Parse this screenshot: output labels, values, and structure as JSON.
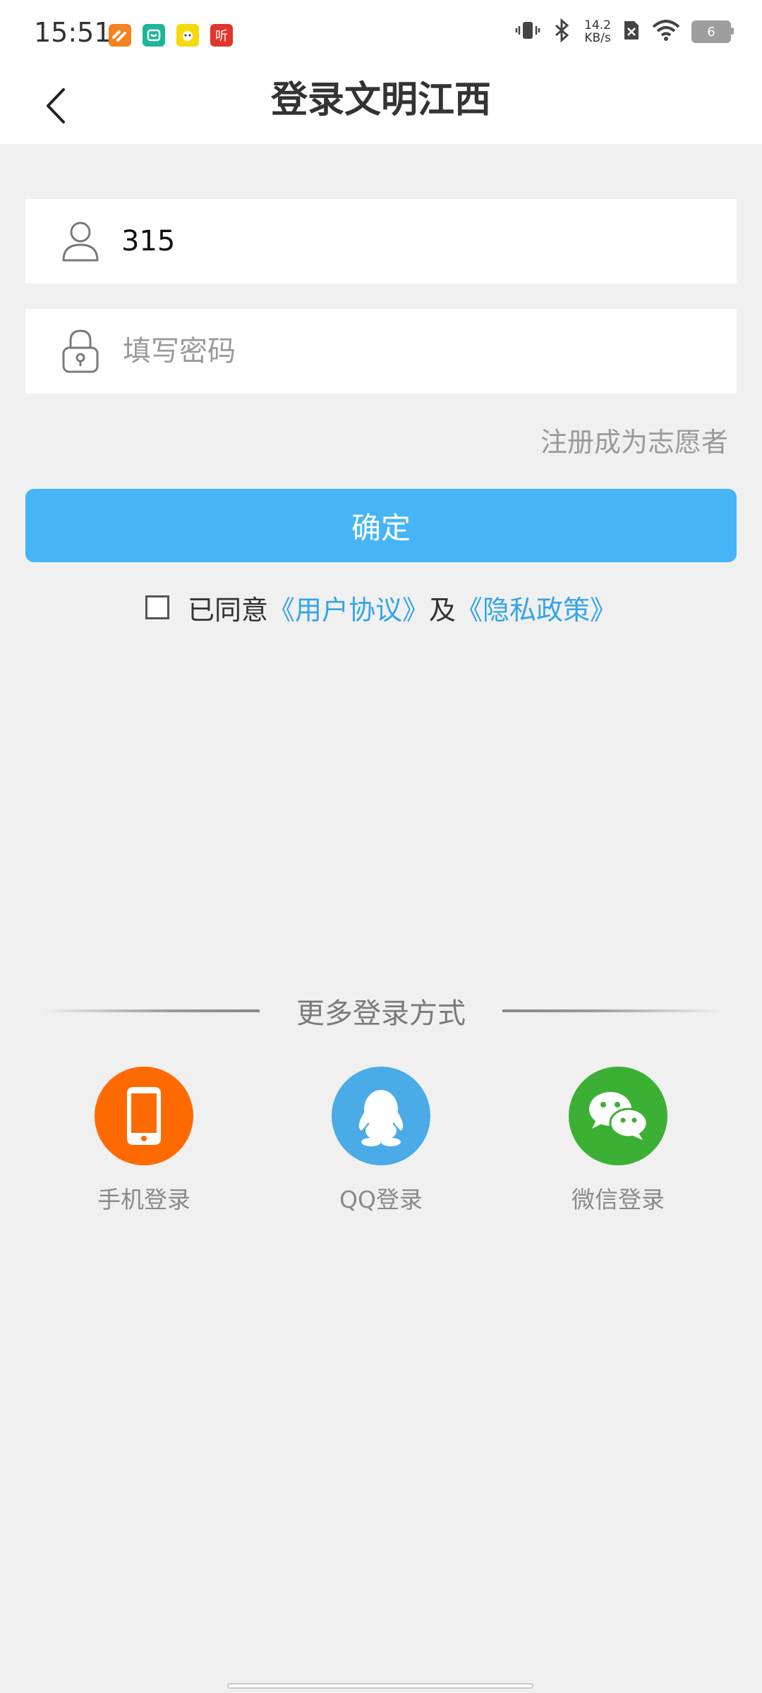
{
  "status_bar": {
    "time": "15:51",
    "net_speed_value": "14.2",
    "net_speed_unit": "KB/s",
    "battery_level": "6",
    "icons": [
      "vibrate-icon",
      "bluetooth-icon",
      "sim-off-icon",
      "wifi-icon",
      "battery-icon"
    ],
    "app_icons": [
      {
        "name": "app-orange-icon",
        "color": "#f58220",
        "text": ""
      },
      {
        "name": "app-teal-icon",
        "color": "#1fb59a",
        "text": ""
      },
      {
        "name": "app-yellow-icon",
        "color": "#f5d90a",
        "text": ""
      },
      {
        "name": "app-ting-icon",
        "color": "#e0362c",
        "text": "听"
      }
    ]
  },
  "header": {
    "title": "登录文明江西",
    "back_icon": "chevron-left-icon"
  },
  "form": {
    "username_value": "315",
    "password_placeholder": "填写密码",
    "register_link": "注册成为志愿者",
    "confirm_label": "确定"
  },
  "agreement": {
    "prefix": "已同意",
    "user_agreement": "《用户协议》",
    "connector": "及",
    "privacy_policy": "《隐私政策》",
    "checked": false
  },
  "more_login": {
    "title": "更多登录方式",
    "methods": [
      {
        "label": "手机登录",
        "icon": "phone-icon",
        "color": "#ff6a00"
      },
      {
        "label": "QQ登录",
        "icon": "qq-icon",
        "color": "#4aabe6"
      },
      {
        "label": "微信登录",
        "icon": "wechat-icon",
        "color": "#3bb035"
      }
    ]
  },
  "colors": {
    "accent": "#45b5f6",
    "link": "#35a5e6",
    "background": "#f0f0f0"
  }
}
